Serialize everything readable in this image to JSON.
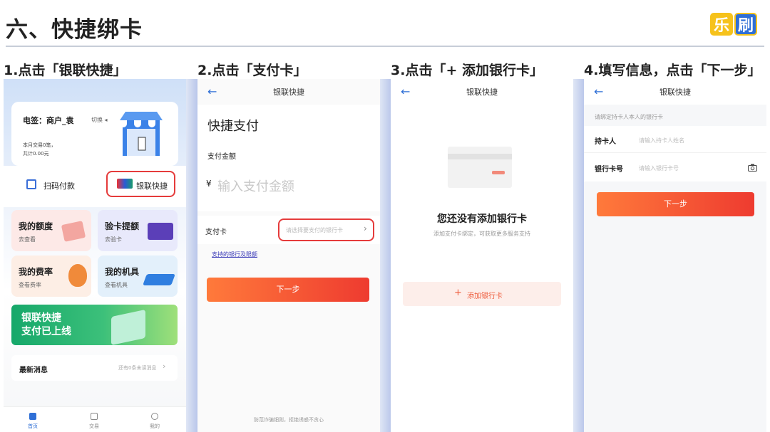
{
  "page": {
    "title": "六、快捷绑卡",
    "logo": [
      "乐",
      "刷"
    ],
    "steps": [
      "1.点击「银联快捷」",
      "2.点击「支付卡」",
      "3.点击「+ 添加银行卡」",
      "4.填写信息，点击「下一步」"
    ]
  },
  "screen1": {
    "merchant": "电签：商户_袁",
    "switch": "切换 ◂",
    "trans1": "本月交易0笔，",
    "trans2": "共计0.00元",
    "scan": "扫码付款",
    "unionpay": "银联快捷",
    "tiles": [
      {
        "title": "我的额度",
        "sub": "去查看"
      },
      {
        "title": "验卡提额",
        "sub": "去验卡"
      },
      {
        "title": "我的费率",
        "sub": "查看费率"
      },
      {
        "title": "我的机具",
        "sub": "查看机具"
      }
    ],
    "banner1": "银联快捷",
    "banner2": "支付已上线",
    "news": "最新消息",
    "news_more": "还有0条未读消息",
    "tabbar": [
      "首页",
      "交易",
      "我的"
    ]
  },
  "screen2": {
    "nav": "银联快捷",
    "heading": "快捷支付",
    "amount_label": "支付金额",
    "currency": "¥",
    "amount_placeholder": "输入支付金额",
    "card_label": "支付卡",
    "card_placeholder": "请选择要支付的银行卡",
    "link": "支持的银行及限额",
    "next": "下一步",
    "footer": "防范诈骗细则，拒绝诱惑不贪心"
  },
  "screen3": {
    "nav": "银联快捷",
    "empty_title": "您还没有添加银行卡",
    "empty_sub": "添加支付卡绑定，可获取更多服务支持",
    "add": "添加银行卡"
  },
  "screen4": {
    "nav": "银联快捷",
    "notice": "请绑定持卡人本人的银行卡",
    "holder_label": "持卡人",
    "holder_placeholder": "请输入持卡人姓名",
    "card_label": "银行卡号",
    "card_placeholder": "请输入银行卡号",
    "next": "下一步"
  }
}
